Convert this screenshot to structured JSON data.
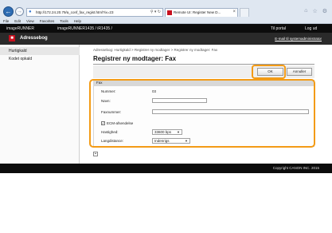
{
  "browser": {
    "url": "http://172.24.20.79/a_conf_fax_regist.html?ix=23",
    "tab_title": "Remote UI: Register New D...",
    "menu": [
      "File",
      "Edit",
      "View",
      "Favorites",
      "Tools",
      "Help"
    ]
  },
  "app": {
    "brand": "imageRUNNER",
    "device": "imageRUNNER1435 / iR1435 /",
    "to_portal": "Til portal",
    "logout": "Log ud",
    "title": "Adressebog",
    "email_admin": "E-mail til systemadministrator"
  },
  "sidebar": {
    "items": [
      {
        "label": "Hurtigkald",
        "active": true
      },
      {
        "label": "Kodet opkald",
        "active": false
      }
    ]
  },
  "main": {
    "breadcrumb": "Adressebog: Hurtigkald > Registrer ny modtager > Registrer ny modtager: Fax",
    "title": "Registrer ny modtager: Fax",
    "ok_label": "OK",
    "cancel_label": "Annuller",
    "fax": {
      "section_label": "Fax",
      "number_label": "Nummer:",
      "number_value": "03",
      "name_label": "Navn:",
      "faxnumber_label": "Faxnummer:",
      "ecm_label": "ECM-afsendelse",
      "ecm_checked": true,
      "speed_label": "Hastighed:",
      "speed_value": "33600 bps",
      "distance_label": "Langdistance:",
      "distance_value": "Indenrigs"
    }
  },
  "footer": {
    "copyright": "Copyright CANON INC. 2015"
  },
  "colors": {
    "highlight": "#f39b16",
    "header_bg": "#0c0c0c",
    "brand_red": "#c8101e"
  }
}
